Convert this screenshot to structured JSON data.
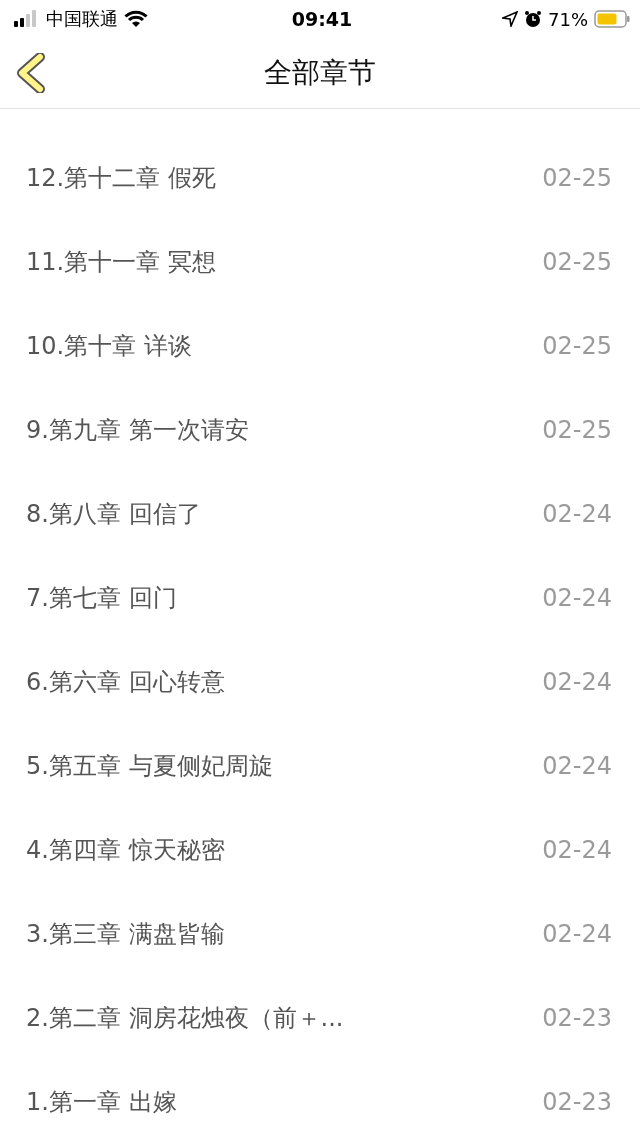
{
  "status_bar": {
    "carrier": "中国联通",
    "time": "09:41",
    "battery": "71%"
  },
  "nav": {
    "title": "全部章节"
  },
  "chapters": [
    {
      "title": "12.第十二章 假死",
      "date": "02-25"
    },
    {
      "title": "11.第十一章 冥想",
      "date": "02-25"
    },
    {
      "title": "10.第十章 详谈",
      "date": "02-25"
    },
    {
      "title": "9.第九章 第一次请安",
      "date": "02-25"
    },
    {
      "title": "8.第八章 回信了",
      "date": "02-24"
    },
    {
      "title": "7.第七章 回门",
      "date": "02-24"
    },
    {
      "title": "6.第六章 回心转意",
      "date": "02-24"
    },
    {
      "title": "5.第五章 与夏侧妃周旋",
      "date": "02-24"
    },
    {
      "title": "4.第四章 惊天秘密",
      "date": "02-24"
    },
    {
      "title": "3.第三章 满盘皆输",
      "date": "02-24"
    },
    {
      "title": "2.第二章 洞房花烛夜（前＋...",
      "date": "02-23"
    },
    {
      "title": "1.第一章 出嫁",
      "date": "02-23"
    }
  ]
}
